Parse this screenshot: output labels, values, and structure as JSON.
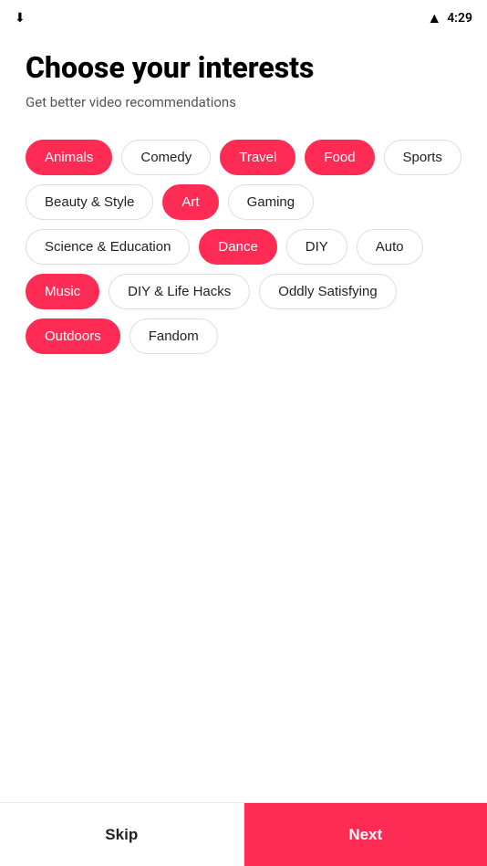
{
  "statusBar": {
    "time": "4:29"
  },
  "page": {
    "title": "Choose your interests",
    "subtitle": "Get better video recommendations"
  },
  "tags": [
    {
      "id": "animals",
      "label": "Animals",
      "selected": true
    },
    {
      "id": "comedy",
      "label": "Comedy",
      "selected": false
    },
    {
      "id": "travel",
      "label": "Travel",
      "selected": true
    },
    {
      "id": "food",
      "label": "Food",
      "selected": true
    },
    {
      "id": "sports",
      "label": "Sports",
      "selected": false
    },
    {
      "id": "beauty-style",
      "label": "Beauty & Style",
      "selected": false
    },
    {
      "id": "art",
      "label": "Art",
      "selected": true
    },
    {
      "id": "gaming",
      "label": "Gaming",
      "selected": false
    },
    {
      "id": "science-education",
      "label": "Science & Education",
      "selected": false
    },
    {
      "id": "dance",
      "label": "Dance",
      "selected": true
    },
    {
      "id": "diy",
      "label": "DIY",
      "selected": false
    },
    {
      "id": "auto",
      "label": "Auto",
      "selected": false
    },
    {
      "id": "music",
      "label": "Music",
      "selected": true
    },
    {
      "id": "diy-life-hacks",
      "label": "DIY & Life Hacks",
      "selected": false
    },
    {
      "id": "oddly-satisfying",
      "label": "Oddly Satisfying",
      "selected": false
    },
    {
      "id": "outdoors",
      "label": "Outdoors",
      "selected": true
    },
    {
      "id": "fandom",
      "label": "Fandom",
      "selected": false
    }
  ],
  "buttons": {
    "skip": "Skip",
    "next": "Next"
  },
  "colors": {
    "accent": "#fe2c55"
  }
}
